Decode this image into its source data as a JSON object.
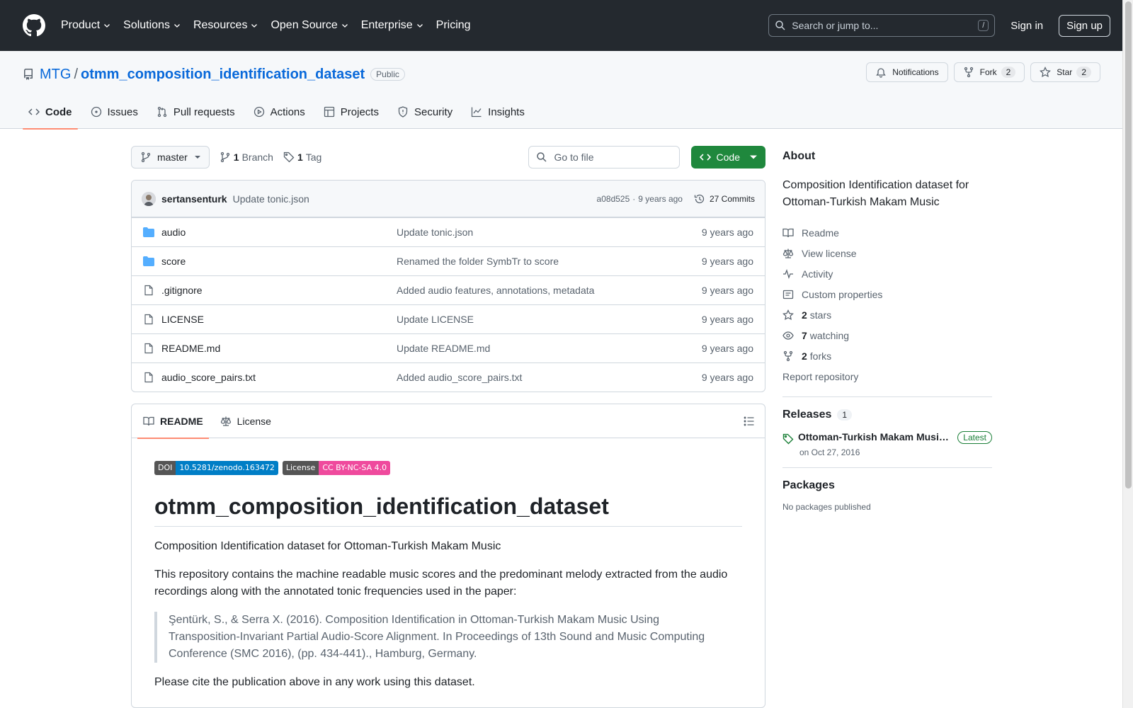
{
  "header": {
    "nav": [
      "Product",
      "Solutions",
      "Resources",
      "Open Source",
      "Enterprise",
      "Pricing"
    ],
    "search_placeholder": "Search or jump to...",
    "search_shortcut": "/",
    "sign_in": "Sign in",
    "sign_up": "Sign up"
  },
  "repo": {
    "owner": "MTG",
    "separator": "/",
    "name": "otmm_composition_identification_dataset",
    "visibility": "Public",
    "notifications_label": "Notifications",
    "fork_label": "Fork",
    "fork_count": "2",
    "star_label": "Star",
    "star_count": "2"
  },
  "tabs": [
    {
      "label": "Code",
      "icon": "code-icon",
      "active": true
    },
    {
      "label": "Issues",
      "icon": "issue-icon"
    },
    {
      "label": "Pull requests",
      "icon": "pull-request-icon"
    },
    {
      "label": "Actions",
      "icon": "play-icon"
    },
    {
      "label": "Projects",
      "icon": "table-icon"
    },
    {
      "label": "Security",
      "icon": "shield-icon"
    },
    {
      "label": "Insights",
      "icon": "graph-icon"
    }
  ],
  "toolbar": {
    "branch": "master",
    "branch_count": "1",
    "branch_label": "Branch",
    "tag_count": "1",
    "tag_label": "Tag",
    "goto_placeholder": "Go to file",
    "code_label": "Code"
  },
  "commit": {
    "author": "sertansenturk",
    "message": "Update tonic.json",
    "hash": "a08d525",
    "sep": "·",
    "age": "9 years ago",
    "commits_label": "27 Commits"
  },
  "files": [
    {
      "name": "audio",
      "type": "folder",
      "message": "Update tonic.json",
      "age": "9 years ago"
    },
    {
      "name": "score",
      "type": "folder",
      "message": "Renamed the folder SymbTr to score",
      "age": "9 years ago"
    },
    {
      "name": ".gitignore",
      "type": "file",
      "message": "Added audio features, annotations, metadata",
      "age": "9 years ago"
    },
    {
      "name": "LICENSE",
      "type": "file",
      "message": "Update LICENSE",
      "age": "9 years ago"
    },
    {
      "name": "README.md",
      "type": "file",
      "message": "Update README.md",
      "age": "9 years ago"
    },
    {
      "name": "audio_score_pairs.txt",
      "type": "file",
      "message": "Added audio_score_pairs.txt",
      "age": "9 years ago"
    }
  ],
  "readme": {
    "tab_readme": "README",
    "tab_license": "License",
    "badge_doi_left": "DOI",
    "badge_doi_right": "10.5281/zenodo.163472",
    "badge_license_left": "License",
    "badge_license_right": "CC BY-NC-SA 4.0",
    "title": "otmm_composition_identification_dataset",
    "p1": "Composition Identification dataset for Ottoman-Turkish Makam Music",
    "p2": "This repository contains the machine readable music scores and the predominant melody extracted from the audio recordings along with the annotated tonic frequencies used in the paper:",
    "quote": "Şentürk, S., & Serra X. (2016). Composition Identification in Ottoman-Turkish Makam Music Using Transposition-Invariant Partial Audio-Score Alignment. In Proceedings of 13th Sound and Music Computing Conference (SMC 2016), (pp. 434-441)., Hamburg, Germany.",
    "p3": "Please cite the publication above in any work using this dataset."
  },
  "about": {
    "title": "About",
    "description": "Composition Identification dataset for Ottoman-Turkish Makam Music",
    "links": {
      "readme": "Readme",
      "license": "View license",
      "activity": "Activity",
      "custom": "Custom properties",
      "stars_count": "2",
      "stars_label": "stars",
      "watching_count": "7",
      "watching_label": "watching",
      "forks_count": "2",
      "forks_label": "forks",
      "report": "Report repository"
    }
  },
  "releases": {
    "title": "Releases",
    "count": "1",
    "name": "Ottoman-Turkish Makam Music Composition Identification Dataset",
    "latest": "Latest",
    "date": "on Oct 27, 2016"
  },
  "packages": {
    "title": "Packages",
    "none": "No packages published"
  },
  "colors": {
    "header_bg": "#24292f",
    "link": "#0969da",
    "primary_button": "#1f883d",
    "tab_underline": "#fd8c73",
    "folder": "#54aeff"
  }
}
